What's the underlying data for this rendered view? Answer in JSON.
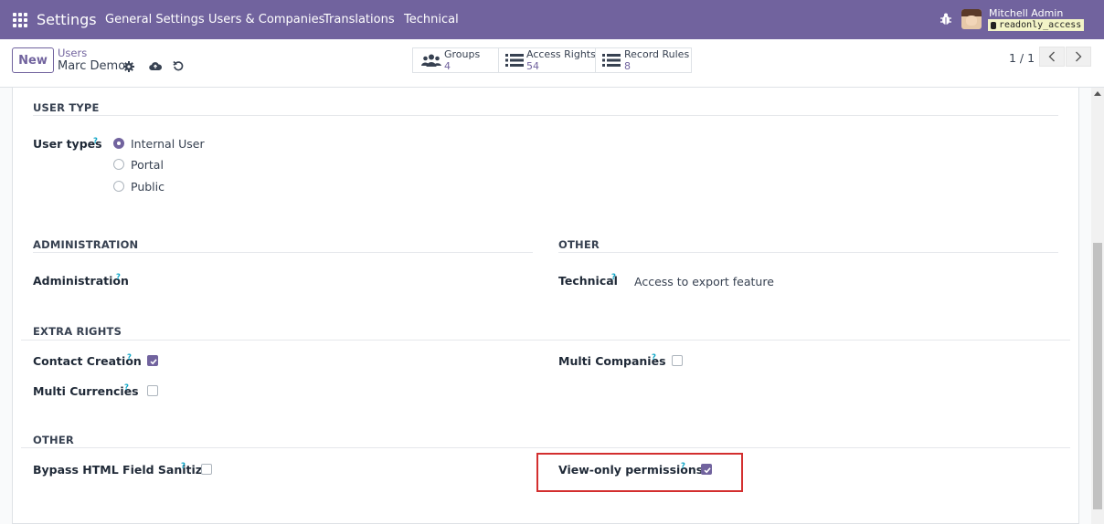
{
  "navbar": {
    "app_title": "Settings",
    "menu": [
      "General Settings",
      "Users & Companies",
      "Translations",
      "Technical"
    ],
    "user_name": "Mitchell Admin",
    "db_name": "readonly_access"
  },
  "control": {
    "new_label": "New",
    "breadcrumb_parent": "Users",
    "breadcrumb_current": "Marc Demo",
    "smart_buttons": [
      {
        "label": "Groups",
        "count": "4",
        "icon": "users-icon"
      },
      {
        "label": "Access Rights",
        "count": "54",
        "icon": "list-icon"
      },
      {
        "label": "Record Rules",
        "count": "8",
        "icon": "list-icon"
      }
    ],
    "pager": "1 / 1"
  },
  "form": {
    "user_type": {
      "section": "USER TYPE",
      "label": "User types",
      "help": "?",
      "options": [
        "Internal User",
        "Portal",
        "Public"
      ],
      "selected": "Internal User"
    },
    "administration": {
      "section": "ADMINISTRATION",
      "label": "Administration",
      "help": "?"
    },
    "other_top": {
      "section": "OTHER",
      "label": "Technical",
      "help": "?",
      "value": "Access to export feature"
    },
    "extra_rights": {
      "section": "EXTRA RIGHTS",
      "contact_creation": {
        "label": "Contact Creation",
        "help": "?",
        "checked": true
      },
      "multi_currencies": {
        "label": "Multi Currencies",
        "help": "?",
        "checked": false
      },
      "multi_companies": {
        "label": "Multi Companies",
        "help": "?",
        "checked": false
      }
    },
    "other_bottom": {
      "section": "OTHER",
      "bypass_html": {
        "label": "Bypass HTML Field Sanitize",
        "help": "?",
        "checked": false
      },
      "view_only": {
        "label": "View-only permissions",
        "help": "?",
        "checked": true
      }
    }
  },
  "colors": {
    "brand": "#71639e",
    "highlight": "#d32f2f",
    "help": "#0ea5c6"
  }
}
